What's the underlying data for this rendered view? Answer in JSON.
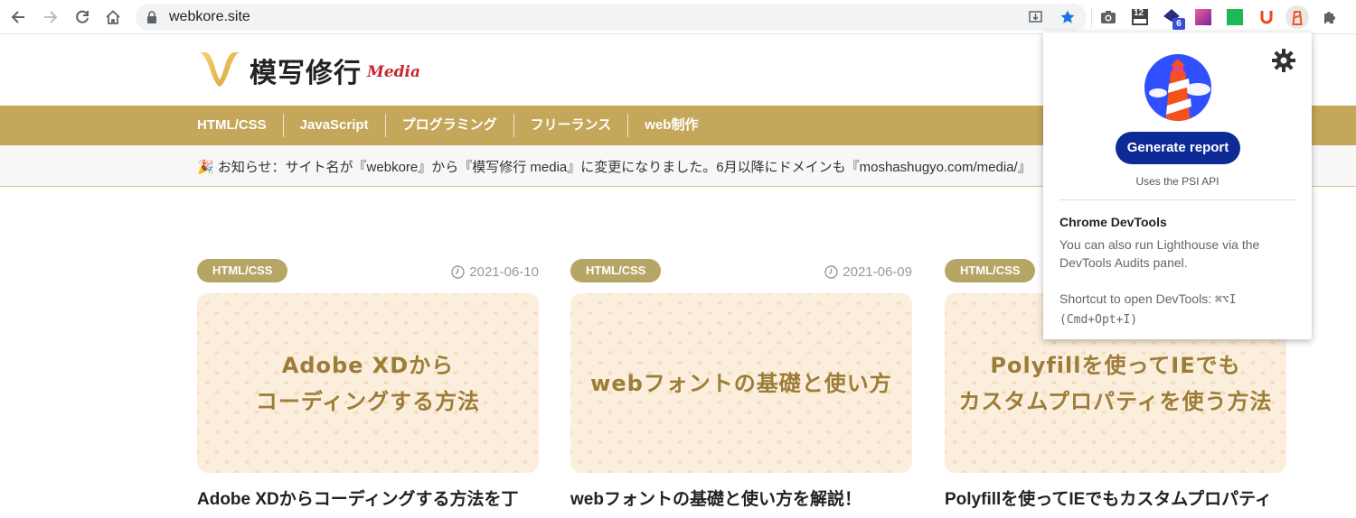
{
  "browser": {
    "url": "webkore.site",
    "extension_badge": "6",
    "extension_counter": "12"
  },
  "site": {
    "logo_text": "模写修行",
    "logo_sub": "Media",
    "nav": [
      "HTML/CSS",
      "JavaScript",
      "プログラミング",
      "フリーランス",
      "web制作"
    ],
    "notice": "🎉 お知らせ：サイト名が『webkore』から『模写修行 media』に変更になりました。6月以降にドメインも『moshashugyo.com/media/』"
  },
  "cards": [
    {
      "tag": "HTML/CSS",
      "date": "2021-06-10",
      "thumb_lines": [
        "Adobe XDから",
        "コーディングする方法"
      ],
      "title": "Adobe XDからコーディングする方法を丁"
    },
    {
      "tag": "HTML/CSS",
      "date": "2021-06-09",
      "thumb_lines": [
        "webフォントの基礎と使い方"
      ],
      "title": "webフォントの基礎と使い方を解説！"
    },
    {
      "tag": "HTML/CSS",
      "date": "",
      "thumb_lines": [
        "Polyfillを使ってIEでも",
        "カスタムプロパティを使う方法"
      ],
      "title": "Polyfillを使ってIEでもカスタムプロパティ"
    }
  ],
  "popup": {
    "generate_label": "Generate report",
    "psi_note": "Uses the PSI API",
    "devtools_heading": "Chrome DevTools",
    "devtools_body": "You can also run Lighthouse via the DevTools Audits panel.",
    "shortcut_label": "Shortcut to open DevTools: ",
    "shortcut_keys": "⌘⌥I",
    "shortcut_alt": "(Cmd+Opt+I)"
  },
  "colors": {
    "nav_bg": "#c4a75a",
    "tag_bg": "#b6a665",
    "button_bg": "#0d2a96",
    "thumb_text": "#9c7d38"
  }
}
